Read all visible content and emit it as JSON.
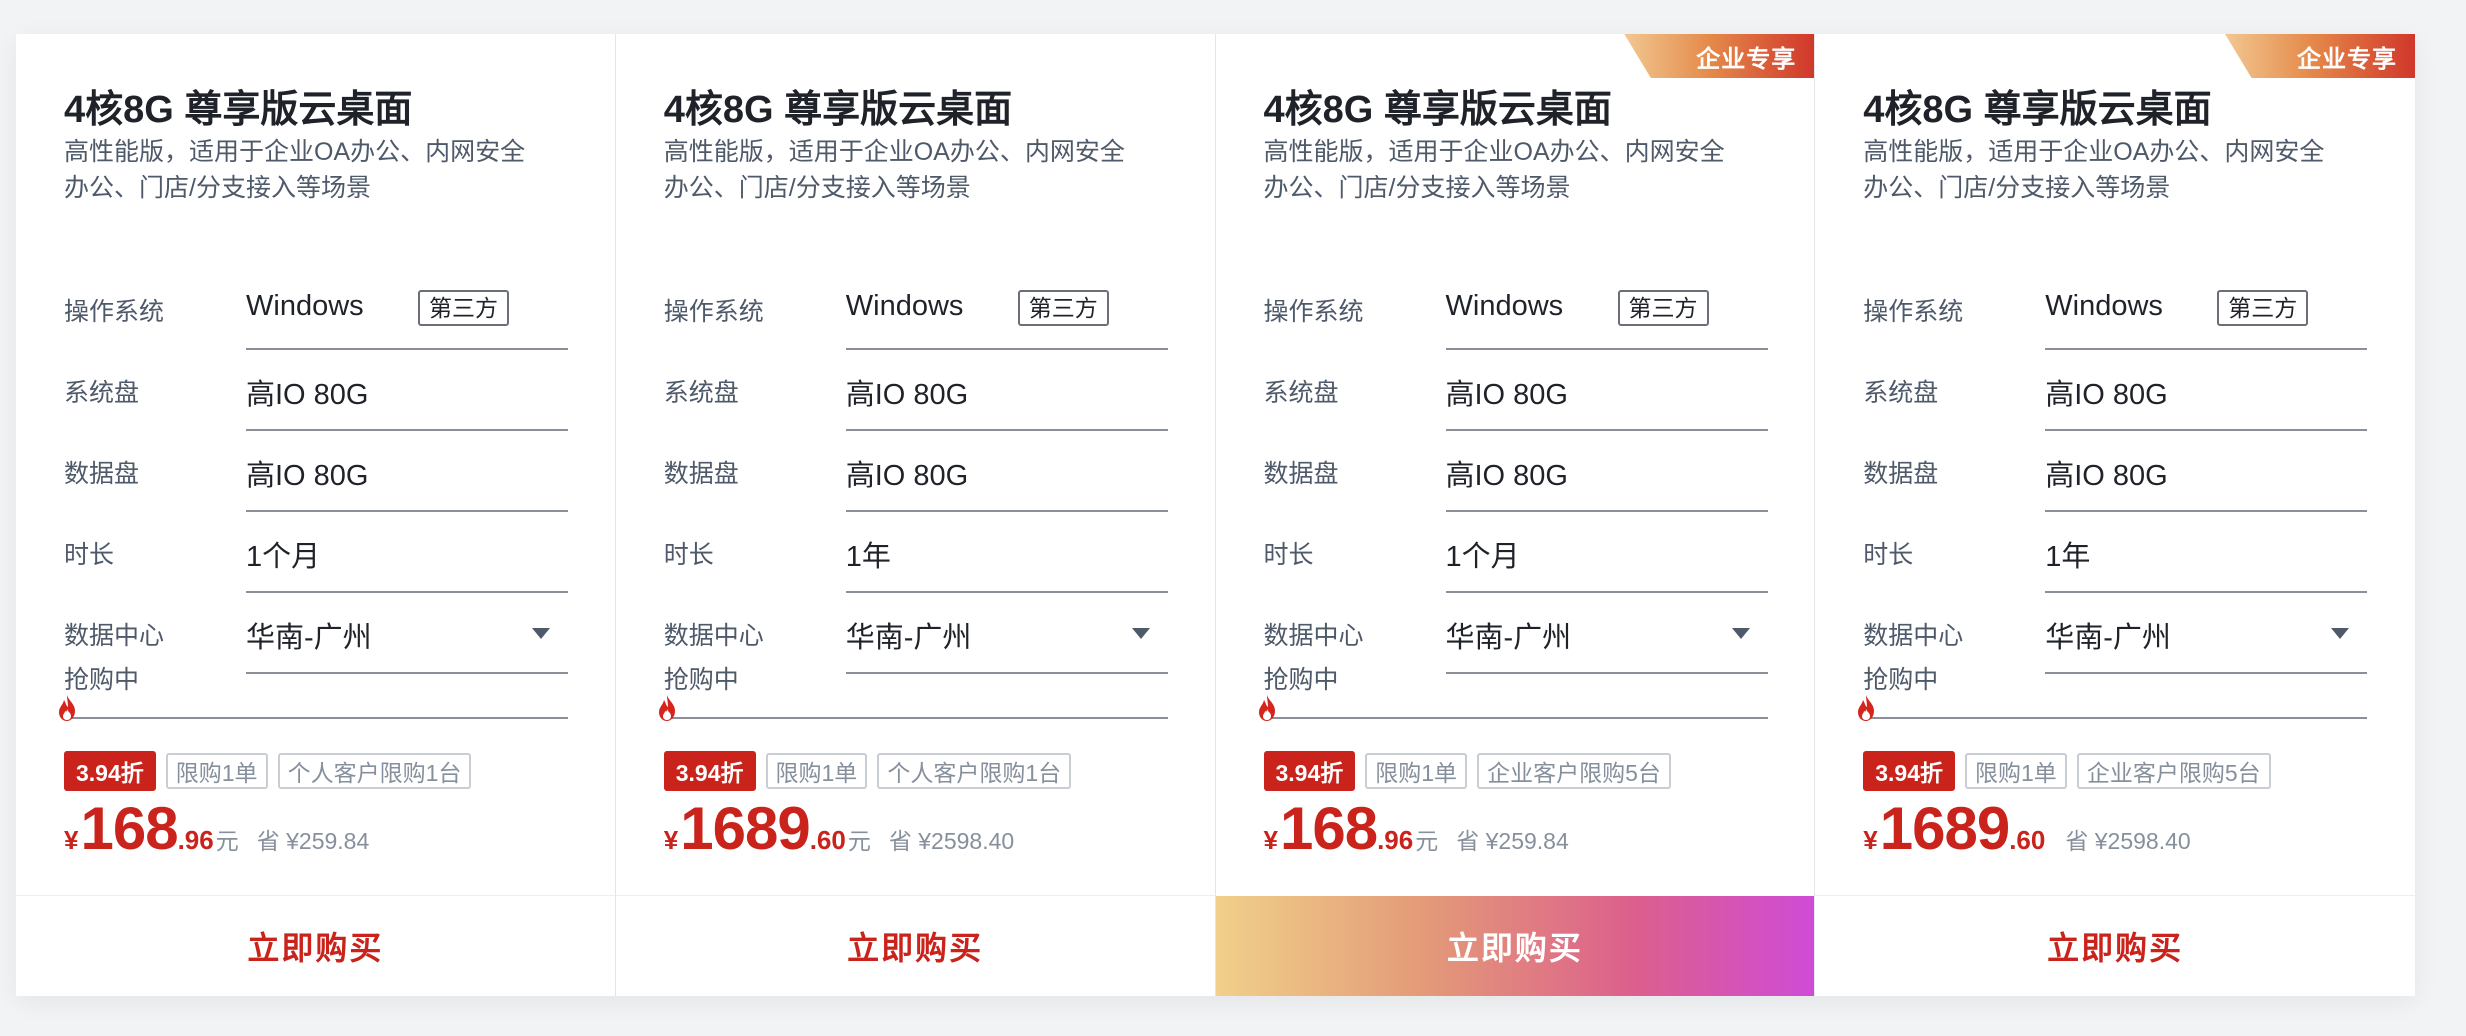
{
  "labels": {
    "os": "操作系统",
    "sys_disk": "系统盘",
    "data_disk": "数据盘",
    "duration": "时长",
    "datacenter": "数据中心",
    "promo": "抢购中",
    "currency": "¥",
    "unit": "元",
    "buy": "立即购买"
  },
  "colors": {
    "accent": "#c9231c",
    "ribbon_gradient": [
      "#f1c892",
      "#d0372b"
    ],
    "buy_gradient": [
      "#f0d08a",
      "#cf4bd6"
    ]
  },
  "cards": [
    {
      "ribbon": "",
      "title": "4核8G 尊享版云桌面",
      "desc": "高性能版，适用于企业OA办公、内网安全办公、门店/分支接入等场景",
      "os": "Windows",
      "os_tag": "第三方",
      "sys_disk": "高IO 80G",
      "data_disk": "高IO 80G",
      "duration": "1个月",
      "datacenter": "华南-广州",
      "discount": "3.94折",
      "limit1": "限购1单",
      "limit2": "个人客户限购1台",
      "price_int": "168",
      "price_dec": ".96",
      "price_unit": "元",
      "save": "省 ¥259.84",
      "buy_highlight": false
    },
    {
      "ribbon": "",
      "title": "4核8G 尊享版云桌面",
      "desc": "高性能版，适用于企业OA办公、内网安全办公、门店/分支接入等场景",
      "os": "Windows",
      "os_tag": "第三方",
      "sys_disk": "高IO 80G",
      "data_disk": "高IO 80G",
      "duration": "1年",
      "datacenter": "华南-广州",
      "discount": "3.94折",
      "limit1": "限购1单",
      "limit2": "个人客户限购1台",
      "price_int": "1689",
      "price_dec": ".60",
      "price_unit": "元",
      "save": "省 ¥2598.40",
      "buy_highlight": false
    },
    {
      "ribbon": "企业专享",
      "title": "4核8G 尊享版云桌面",
      "desc": "高性能版，适用于企业OA办公、内网安全办公、门店/分支接入等场景",
      "os": "Windows",
      "os_tag": "第三方",
      "sys_disk": "高IO 80G",
      "data_disk": "高IO 80G",
      "duration": "1个月",
      "datacenter": "华南-广州",
      "discount": "3.94折",
      "limit1": "限购1单",
      "limit2": "企业客户限购5台",
      "price_int": "168",
      "price_dec": ".96",
      "price_unit": "元",
      "save": "省 ¥259.84",
      "buy_highlight": true
    },
    {
      "ribbon": "企业专享",
      "title": "4核8G 尊享版云桌面",
      "desc": "高性能版，适用于企业OA办公、内网安全办公、门店/分支接入等场景",
      "os": "Windows",
      "os_tag": "第三方",
      "sys_disk": "高IO 80G",
      "data_disk": "高IO 80G",
      "duration": "1年",
      "datacenter": "华南-广州",
      "discount": "3.94折",
      "limit1": "限购1单",
      "limit2": "企业客户限购5台",
      "price_int": "1689",
      "price_dec": ".60",
      "price_unit": "",
      "save": "省 ¥2598.40",
      "buy_highlight": false
    }
  ]
}
